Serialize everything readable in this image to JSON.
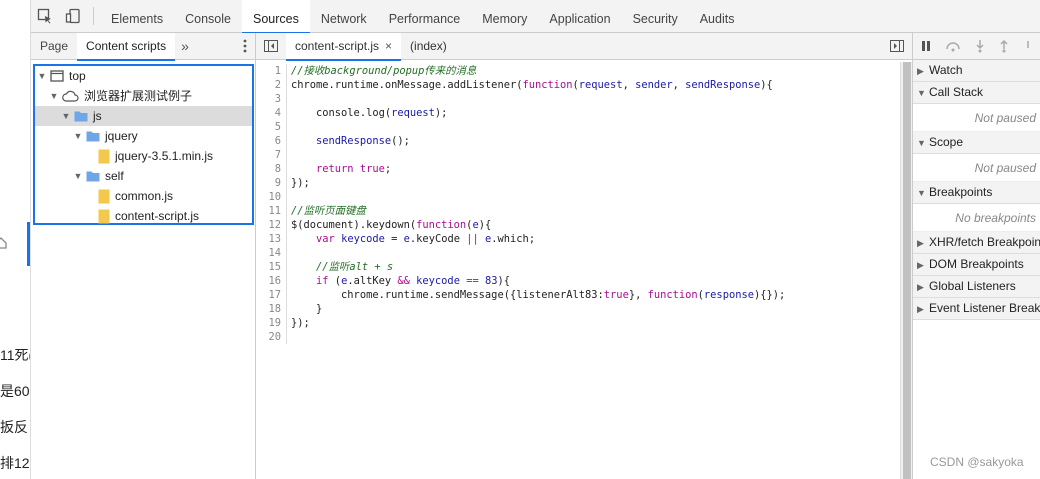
{
  "page_fragments": [
    "11死(",
    "是60",
    "扳反",
    "排12"
  ],
  "toolbar": {
    "tabs": [
      "Elements",
      "Console",
      "Sources",
      "Network",
      "Performance",
      "Memory",
      "Application",
      "Security",
      "Audits"
    ],
    "active_tab": "Sources"
  },
  "navigator": {
    "tabs": [
      "Page",
      "Content scripts"
    ],
    "active_tab": "Content scripts",
    "more": "»",
    "tree": [
      {
        "label": "top",
        "icon": "frame-icon",
        "depth": 0,
        "expanded": true
      },
      {
        "label": "浏览器扩展测试例子",
        "icon": "cloud-icon",
        "depth": 1,
        "expanded": true
      },
      {
        "label": "js",
        "icon": "folder-icon",
        "depth": 2,
        "expanded": true,
        "selected": true
      },
      {
        "label": "jquery",
        "icon": "folder-icon",
        "depth": 3,
        "expanded": true
      },
      {
        "label": "jquery-3.5.1.min.js",
        "icon": "file-icon",
        "depth": 4
      },
      {
        "label": "self",
        "icon": "folder-icon",
        "depth": 3,
        "expanded": true
      },
      {
        "label": "common.js",
        "icon": "file-icon",
        "depth": 4
      },
      {
        "label": "content-script.js",
        "icon": "file-icon",
        "depth": 4
      }
    ]
  },
  "editor": {
    "tabs": [
      {
        "label": "content-script.js",
        "close": "×",
        "active": true
      },
      {
        "label": "(index)",
        "close": "",
        "active": false
      }
    ],
    "lines": [
      "//接收background/popup传来的消息",
      "chrome.runtime.onMessage.addListener(function(request, sender, sendResponse){",
      "",
      "    console.log(request);",
      "",
      "    sendResponse();",
      "",
      "    return true;",
      "});",
      "",
      "//监听页面键盘",
      "$(document).keydown(function(e){",
      "    var keycode = e.keyCode || e.which;",
      "",
      "    //监听alt + s",
      "    if (e.altKey && keycode == 83){",
      "        chrome.runtime.sendMessage({listenerAlt83:true}, function(response){});",
      "    }",
      "});",
      ""
    ]
  },
  "debugger": {
    "sections": [
      {
        "title": "Watch",
        "expanded": false,
        "body": ""
      },
      {
        "title": "Call Stack",
        "expanded": true,
        "body": "Not paused"
      },
      {
        "title": "Scope",
        "expanded": true,
        "body": "Not paused"
      },
      {
        "title": "Breakpoints",
        "expanded": true,
        "body": "No breakpoints"
      },
      {
        "title": "XHR/fetch Breakpoints",
        "expanded": false,
        "body": ""
      },
      {
        "title": "DOM Breakpoints",
        "expanded": false,
        "body": ""
      },
      {
        "title": "Global Listeners",
        "expanded": false,
        "body": ""
      },
      {
        "title": "Event Listener Breakpoints",
        "expanded": false,
        "body": ""
      }
    ]
  },
  "watermark": "CSDN @sakyoka",
  "colors": {
    "accent": "#1a73e8",
    "comment": "#236e25",
    "keyword": "#aa0d91",
    "string": "#1a1aa6",
    "folder": "#6ea6e8",
    "file": "#f2c94c"
  }
}
